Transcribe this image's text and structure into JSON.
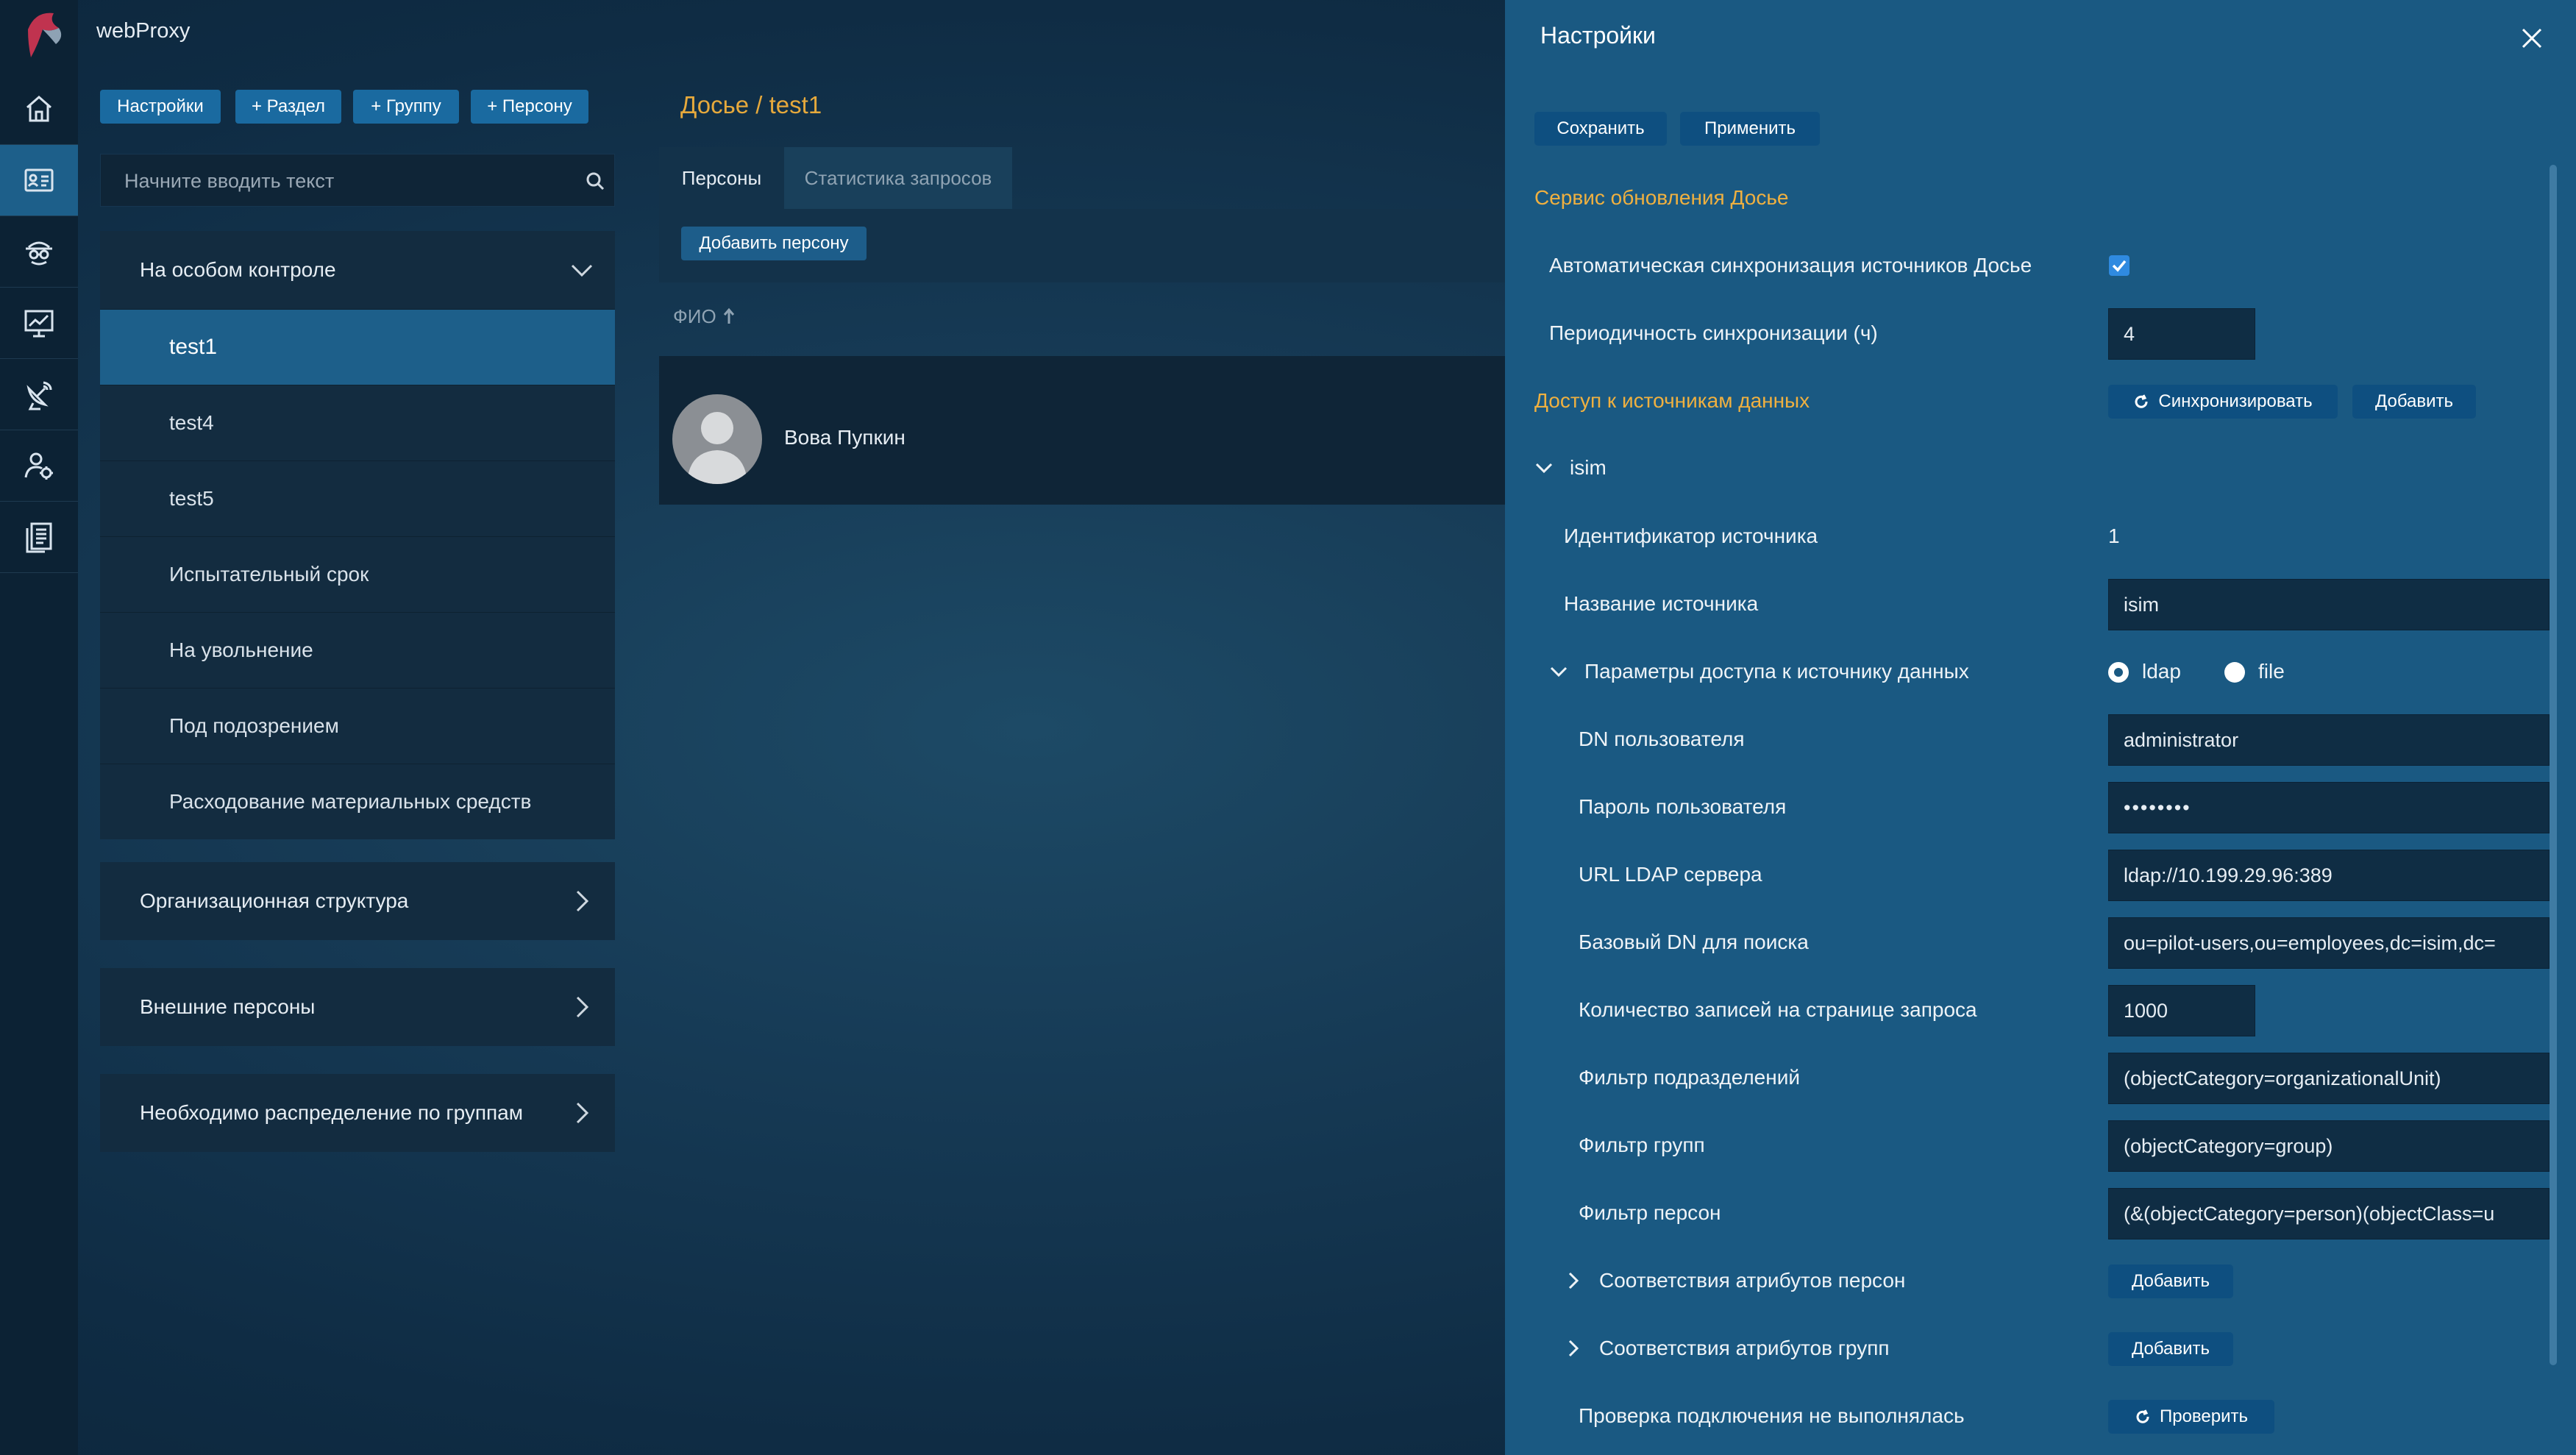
{
  "app": {
    "title": "webProxy"
  },
  "toolbar": {
    "settings": "Настройки",
    "add_section": "+ Раздел",
    "add_group": "+ Группу",
    "add_person": "+ Персону"
  },
  "search": {
    "placeholder": "Начните вводить текст"
  },
  "groups": {
    "special_control": {
      "title": "На особом контроле",
      "items": [
        "test1",
        "test4",
        "test5",
        "Испытательный срок",
        "На увольнение",
        "Под подозрением",
        "Расходование материальных средств"
      ]
    },
    "org_structure": "Организационная структура",
    "external_persons": "Внешние персоны",
    "distribution_needed": "Необходимо распределение по группам"
  },
  "center": {
    "breadcrumb": "Досье / test1",
    "tabs": [
      "Персоны",
      "Статистика запросов"
    ],
    "add_person_button": "Добавить персону",
    "column_header": "ФИО",
    "person_name": "Вова Пупкин"
  },
  "settings": {
    "title": "Настройки",
    "save": "Сохранить",
    "apply": "Применить",
    "section_update": "Сервис обновления Досье",
    "auto_sync_label": "Автоматическая синхронизация источников Досье",
    "auto_sync_checked": true,
    "period_label": "Периодичность синхронизации (ч)",
    "period_value": "4",
    "section_access": "Доступ к источникам данных",
    "sync_button": "Синхронизировать",
    "add_button": "Добавить",
    "source_name": "isim",
    "source_id_label": "Идентификатор источника",
    "source_id_value": "1",
    "source_title_label": "Название источника",
    "source_title_value": "isim",
    "access_params_label": "Параметры доступа к источнику данных",
    "radio_ldap": "ldap",
    "radio_file": "file",
    "user_dn_label": "DN пользователя",
    "user_dn_value": "administrator",
    "password_label": "Пароль пользователя",
    "password_value": "••••••••",
    "ldap_url_label": "URL LDAP сервера",
    "ldap_url_value": "ldap://10.199.29.96:389",
    "base_dn_label": "Базовый DN для поиска",
    "base_dn_value": "ou=pilot-users,ou=employees,dc=isim,dc=",
    "page_size_label": "Количество записей на странице запроса",
    "page_size_value": "1000",
    "ou_filter_label": "Фильтр подразделений",
    "ou_filter_value": "(objectCategory=organizationalUnit)",
    "group_filter_label": "Фильтр групп",
    "group_filter_value": "(objectCategory=group)",
    "person_filter_label": "Фильтр персон",
    "person_filter_value": "(&(objectCategory=person)(objectClass=u",
    "person_attr_label": "Соответствия атрибутов персон",
    "group_attr_label": "Соответствия атрибутов групп",
    "check_status_label": "Проверка подключения не выполнялась",
    "check_button": "Проверить"
  }
}
